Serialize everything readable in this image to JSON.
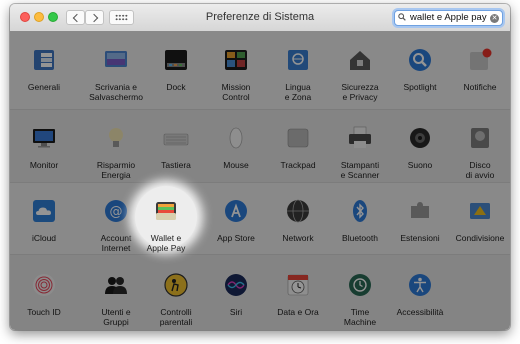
{
  "window": {
    "title": "Preferenze di Sistema"
  },
  "search": {
    "query": "wallet e Apple pay"
  },
  "rows": [
    [
      {
        "name": "generali",
        "label": "Generali"
      },
      {
        "name": "scrivania",
        "label": "Scrivania e\nSalvaschermo"
      },
      {
        "name": "dock",
        "label": "Dock"
      },
      {
        "name": "mission-control",
        "label": "Mission\nControl"
      },
      {
        "name": "lingua",
        "label": "Lingua\ne Zona"
      },
      {
        "name": "sicurezza",
        "label": "Sicurezza\ne Privacy"
      },
      {
        "name": "spotlight",
        "label": "Spotlight"
      },
      {
        "name": "notifiche",
        "label": "Notifiche"
      }
    ],
    [
      {
        "name": "monitor",
        "label": "Monitor"
      },
      {
        "name": "risparmio-energia",
        "label": "Risparmio\nEnergia"
      },
      {
        "name": "tastiera",
        "label": "Tastiera"
      },
      {
        "name": "mouse",
        "label": "Mouse"
      },
      {
        "name": "trackpad",
        "label": "Trackpad"
      },
      {
        "name": "stampanti",
        "label": "Stampanti\ne Scanner"
      },
      {
        "name": "suono",
        "label": "Suono"
      },
      {
        "name": "disco-avvio",
        "label": "Disco\ndi avvio"
      }
    ],
    [
      {
        "name": "icloud",
        "label": "iCloud"
      },
      {
        "name": "account-internet",
        "label": "Account\nInternet"
      },
      {
        "name": "wallet-apple-pay",
        "label": "Wallet e\nApple Pay"
      },
      {
        "name": "app-store",
        "label": "App Store"
      },
      {
        "name": "network",
        "label": "Network"
      },
      {
        "name": "bluetooth",
        "label": "Bluetooth"
      },
      {
        "name": "estensioni",
        "label": "Estensioni"
      },
      {
        "name": "condivisione",
        "label": "Condivisione"
      }
    ],
    [
      {
        "name": "touch-id",
        "label": "Touch ID"
      },
      {
        "name": "utenti-gruppi",
        "label": "Utenti e\nGruppi"
      },
      {
        "name": "controlli-parentali",
        "label": "Controlli\nparentali"
      },
      {
        "name": "siri",
        "label": "Siri"
      },
      {
        "name": "data-ora",
        "label": "Data e Ora"
      },
      {
        "name": "time-machine",
        "label": "Time\nMachine"
      },
      {
        "name": "accessibilita",
        "label": "Accessibilità"
      }
    ]
  ]
}
